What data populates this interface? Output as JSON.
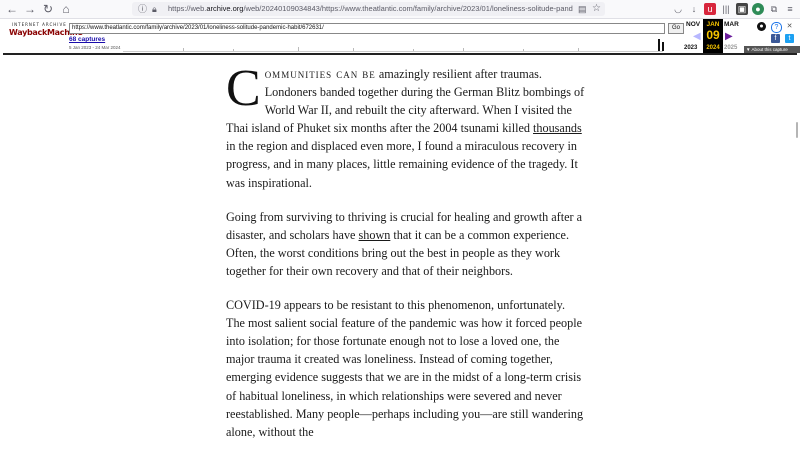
{
  "browser": {
    "url_prefix": "https://web.",
    "url_domain": "archive.org",
    "url_rest": "/web/20240109034843/https://www.theatlantic.com/family/archive/2023/01/loneliness-solitude-pandemi..."
  },
  "wayback": {
    "logo_top": "INTERNET ARCHIVE",
    "logo": "WaybackMachine",
    "url_value": "https://www.theatlantic.com/family/archive/2023/01/loneliness-solitude-pandemic-habit/672631/",
    "go_label": "Go",
    "captures": "68 captures",
    "range": "5 Jan 2023 - 24 Mar 2024",
    "prev_month": "NOV",
    "cur_month": "JAN",
    "next_month": "MAR",
    "cur_day": "09",
    "prev_year": "2023",
    "cur_year": "2024",
    "next_year": "2025",
    "about": "▼ About this capture"
  },
  "article": {
    "dropcap": "C",
    "p1_smallcaps": "ommunities can be",
    "p1_a": " amazingly resilient after traumas. Londoners banded together during the German Blitz bombings of World War II, and rebuilt the city afterward. When I visited the Thai island of Phuket six months after the 2004 tsunami killed ",
    "p1_link": "thousands",
    "p1_b": " in the region and displaced even more, I found a miraculous recovery in progress, and in many places, little remaining evidence of the tragedy. It was inspirational.",
    "p2_a": "Going from surviving to thriving is crucial for healing and growth after a disaster, and scholars have ",
    "p2_link": "shown",
    "p2_b": " that it can be a common experience. Often, the worst conditions bring out the best in people as they work together for their own recovery and that of their neighbors.",
    "p3": "COVID-19 appears to be resistant to this phenomenon, unfortunately. The most salient social feature of the pandemic was how it forced people into isolation; for those fortunate enough not to lose a loved one, the major trauma it created was loneliness. Instead of coming together, emerging evidence suggests that we are in the midst of a long-term crisis of habitual loneliness, in which relationships were severed and never reestablished. Many people—perhaps including you—are still wandering alone, without the"
  }
}
